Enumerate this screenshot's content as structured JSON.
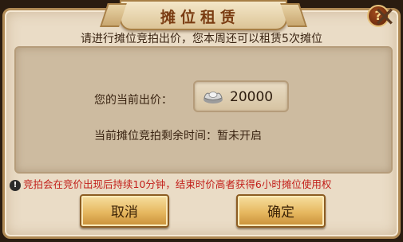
{
  "dialog": {
    "title": "摊位租赁",
    "help_label": "?",
    "close_label": "✕",
    "subtitle": "请进行摊位竞拍出价，您本周还可以租赁5次摊位"
  },
  "bid": {
    "label": "您的当前出价：",
    "currency_icon": "silver-ingot-icon",
    "value": "20000"
  },
  "auction_time": {
    "label": "当前摊位竞拍剩余时间：暂未开启"
  },
  "notice": {
    "icon_label": "!",
    "text": "竞拍会在竞价出现后持续10分钟，结束时价高者获得6小时摊位使用权"
  },
  "buttons": {
    "cancel_label": "取消",
    "confirm_label": "确定"
  },
  "colors": {
    "title": "#7a3c12",
    "notice": "#c21f1a",
    "button": "#e6b860"
  }
}
